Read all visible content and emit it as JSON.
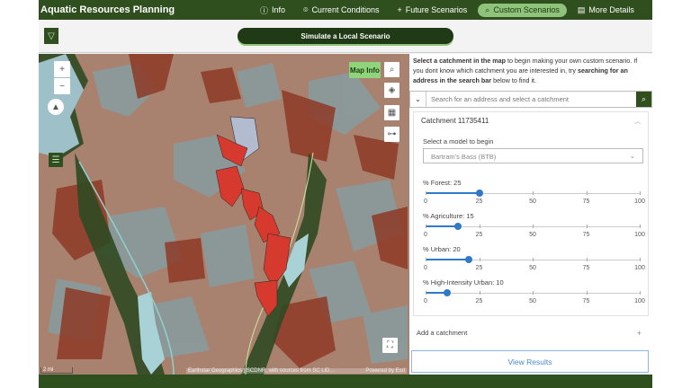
{
  "header": {
    "title": "Aquatic Resources Planning",
    "nav": [
      {
        "label": "Info",
        "icon": "info-icon"
      },
      {
        "label": "Current Conditions",
        "icon": "map-pin-icon"
      },
      {
        "label": "Future Scenarios",
        "icon": "plus-icon"
      },
      {
        "label": "Custom Scenarios",
        "icon": "search-icon",
        "active": true
      },
      {
        "label": "More Details",
        "icon": "document-icon"
      }
    ]
  },
  "toolbar": {
    "simulate_label": "Simulate a Local Scenario"
  },
  "map": {
    "map_info_label": "Map Info",
    "scale": "2 mi",
    "attribution": "Earthstar Geographics | SCDNR, with sources from SC LiD...",
    "powered_by": "Powered by Esri"
  },
  "panel": {
    "intro": {
      "b1": "Select a catchment in the map",
      "t1": " to begin making your own custom scenario. If you dont know which catchment you are interested in, try ",
      "b2": "searching for an address in the search bar",
      "t2": " below to find it."
    },
    "search_placeholder": "Search for an address and select a catchment",
    "catchment_title": "Catchment 11735411",
    "model_label": "Select a model to begin",
    "model_value": "Bartram's Bass (BTB)",
    "sliders": [
      {
        "label": "% Forest: 25",
        "value": 25
      },
      {
        "label": "% Agriculture: 15",
        "value": 15
      },
      {
        "label": "% Urban: 20",
        "value": 20
      },
      {
        "label": "% High-Intensity Urban: 10",
        "value": 10
      }
    ],
    "ticks": [
      "0",
      "25",
      "50",
      "75",
      "100"
    ],
    "add_catchment": "Add a catchment",
    "view_results": "View Results"
  },
  "colors": {
    "brand": "#2f4f1f",
    "accent": "#8fc27a",
    "slider": "#2f79c9",
    "selected_catchment": "#d63a2f"
  }
}
